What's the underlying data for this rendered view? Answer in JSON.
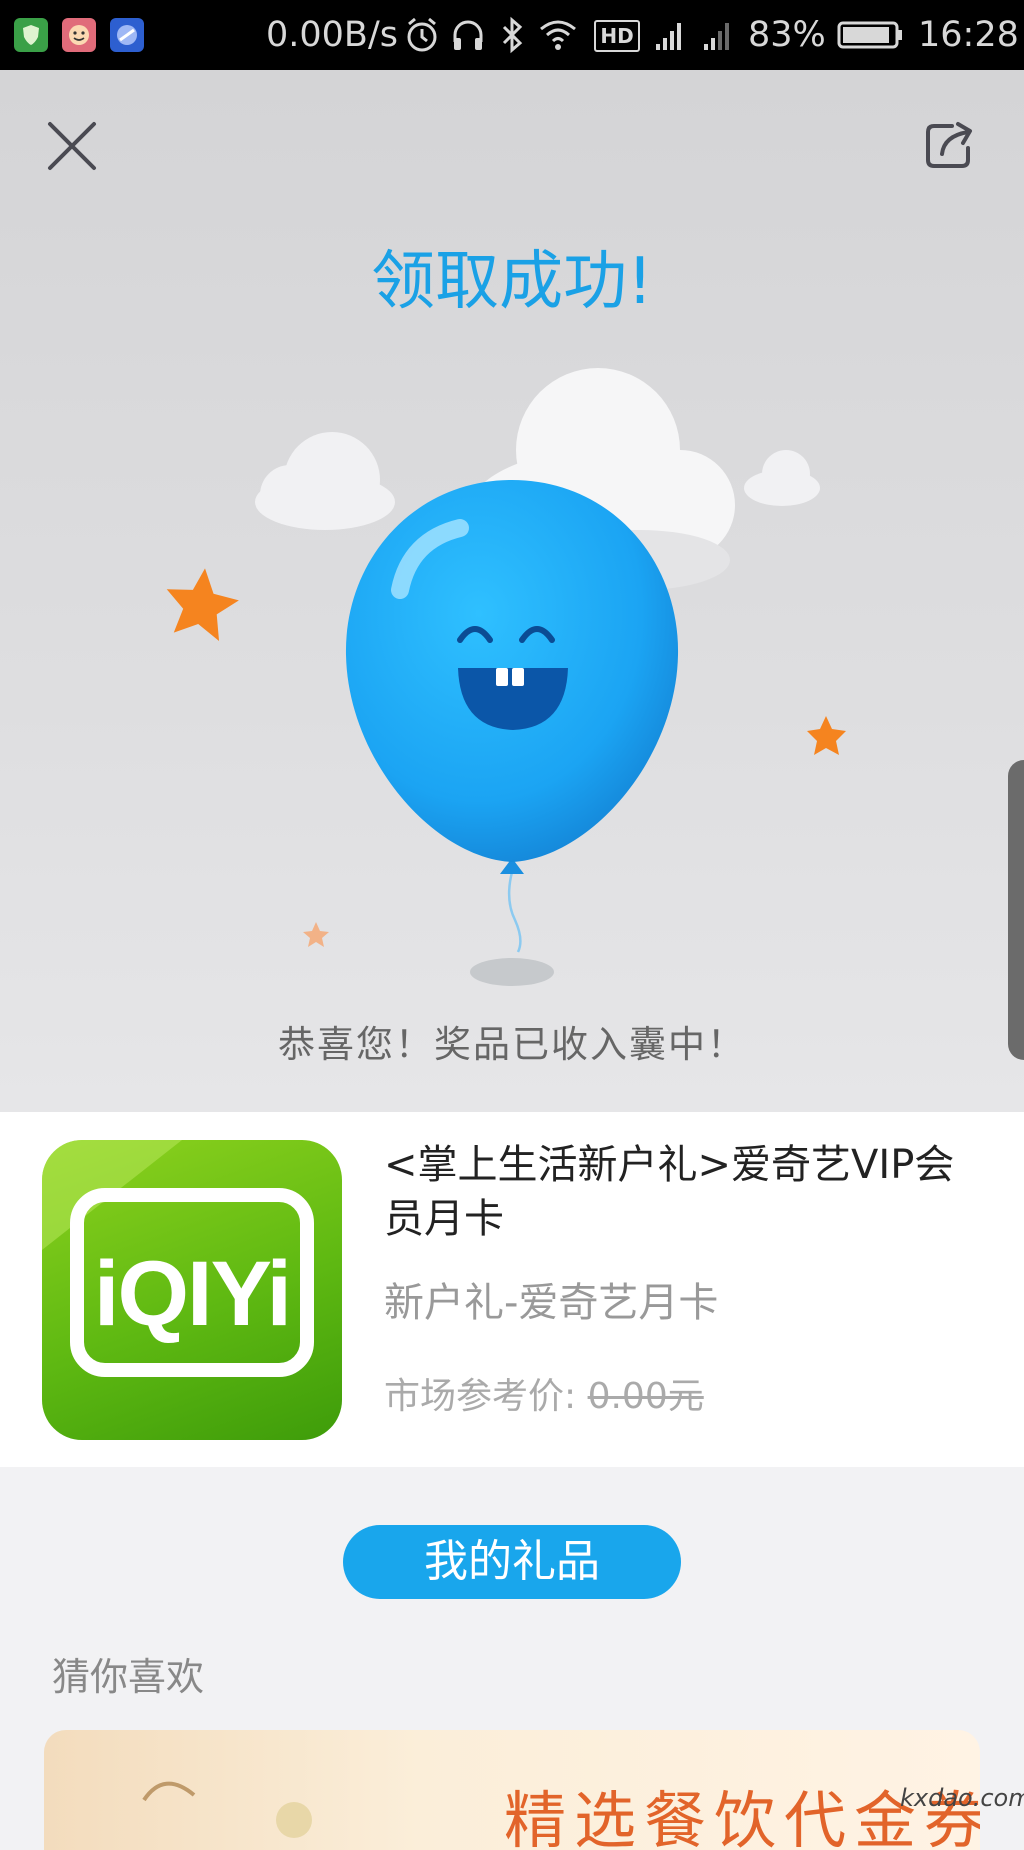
{
  "status_bar": {
    "net_speed": "0.00B/s",
    "hd_badge": "HD",
    "battery_pct": "83%",
    "time": "16:28",
    "icons": [
      "shield-app-icon",
      "face-app-icon",
      "browser-app-icon",
      "alarm-icon",
      "headphones-icon",
      "bluetooth-icon",
      "wifi-icon",
      "hd-icon",
      "signal-icon",
      "signal-icon",
      "battery-icon"
    ]
  },
  "header": {
    "close_icon": "close-icon",
    "share_icon": "share-icon"
  },
  "hero": {
    "title": "领取成功!",
    "congrats": "恭喜您！奖品已收入囊中！",
    "colors": {
      "title": "#1aa1e6",
      "balloon": "#1fa9f5",
      "star": "#f5841f"
    }
  },
  "prize": {
    "logo_text": "iQIYi",
    "title": "<掌上生活新户礼>爱奇艺VIP会员月卡",
    "subtitle": "新户礼-爱奇艺月卡",
    "price_label": "市场参考价: ",
    "price_value": "0.00元"
  },
  "actions": {
    "my_gifts": "我的礼品"
  },
  "recommend": {
    "heading": "猜你喜欢",
    "banner_text": "精选餐饮代金券"
  },
  "watermark": "kxdao.com"
}
